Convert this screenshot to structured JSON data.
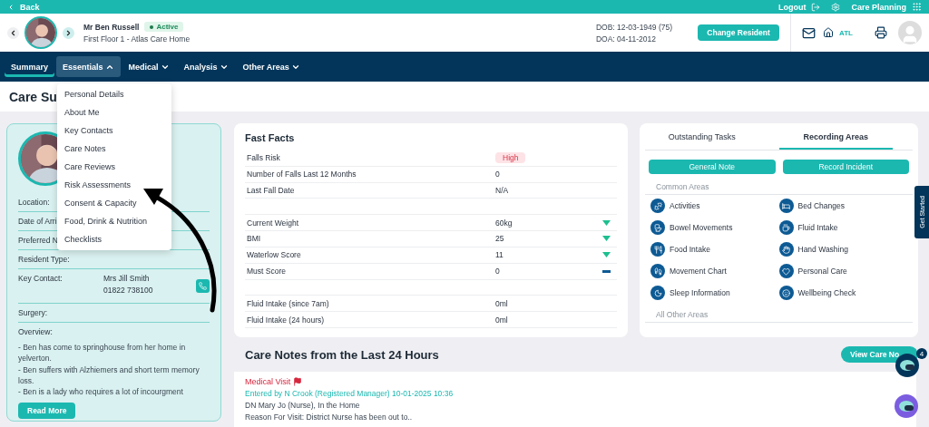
{
  "top_bar": {
    "back": "Back",
    "logout": "Logout",
    "app": "Care Planning"
  },
  "resident": {
    "name": "Mr Ben Russell",
    "status": "Active",
    "location": "First Floor 1 - Atlas Care Home",
    "dob": "DOB: 12-03-1949 (75)",
    "doa": "DOA: 04-11-2012",
    "change_button": "Change Resident",
    "home_code": "ATL"
  },
  "nav": [
    {
      "label": "Summary",
      "selected": true,
      "expanded": false,
      "dropdown": false
    },
    {
      "label": "Essentials",
      "selected": false,
      "expanded": true,
      "dropdown": true
    },
    {
      "label": "Medical",
      "selected": false,
      "expanded": false,
      "dropdown": true
    },
    {
      "label": "Analysis",
      "selected": false,
      "expanded": false,
      "dropdown": true
    },
    {
      "label": "Other Areas",
      "selected": false,
      "expanded": false,
      "dropdown": true
    }
  ],
  "dropdown_items": [
    "Personal Details",
    "About Me",
    "Key Contacts",
    "Care Notes",
    "Care Reviews",
    "Risk Assessments",
    "Consent & Capacity",
    "Food, Drink & Nutrition",
    "Checklists"
  ],
  "page_title": "Care Su",
  "profile": {
    "rows": [
      {
        "label": "Location:"
      },
      {
        "label": "Date of Arri"
      },
      {
        "label": "Preferred N"
      },
      {
        "label": "Resident Type:"
      }
    ],
    "key_contact": {
      "label": "Key Contact:",
      "name": "Mrs Jill Smith",
      "phone": "01822 738100"
    },
    "surgery": "Surgery:",
    "overview_label": "Overview:",
    "overview": [
      "- Ben has come to springhouse from her home in yelverton.",
      "- Ben suffers with Alzhiemers and short term memory loss.",
      "- Ben is a lady who requires a lot of incourgment"
    ],
    "read_more": "Read More"
  },
  "fast_facts": {
    "title": "Fast Facts",
    "rows": [
      {
        "kind": "badge",
        "label": "Falls Risk",
        "value": "High"
      },
      {
        "kind": "text",
        "label": "Number of Falls Last 12 Months",
        "value": "0"
      },
      {
        "kind": "text",
        "label": "Last Fall Date",
        "value": "N/A"
      },
      {
        "kind": "gap"
      },
      {
        "kind": "text",
        "label": "Current Weight",
        "value": "60kg",
        "trend_down": true
      },
      {
        "kind": "text",
        "label": "BMI",
        "value": "25",
        "trend_down": true
      },
      {
        "kind": "text",
        "label": "Waterlow Score",
        "value": "11",
        "trend_down": true
      },
      {
        "kind": "text",
        "label": "Must Score",
        "value": "0",
        "trend_down": false
      },
      {
        "kind": "gap"
      },
      {
        "kind": "text",
        "label": "Fluid Intake (since 7am)",
        "value": "0ml"
      },
      {
        "kind": "text",
        "label": "Fluid Intake (24 hours)",
        "value": "0ml"
      }
    ]
  },
  "recording": {
    "tabs": [
      {
        "label": "Outstanding Tasks",
        "selected": false
      },
      {
        "label": "Recording Areas",
        "selected": true
      }
    ],
    "buttons": [
      "General Note",
      "Record Incident"
    ],
    "common_label": "Common Areas",
    "areas": [
      "Activities",
      "Bed Changes",
      "Bowel Movements",
      "Fluid Intake",
      "Food Intake",
      "Hand Washing",
      "Movement Chart",
      "Personal Care",
      "Sleep Information",
      "Wellbeing Check"
    ],
    "other_label": "All Other Areas"
  },
  "care_notes": {
    "title": "Care Notes from the Last 24 Hours",
    "view_button": "View Care No",
    "note": {
      "title": "Medical Visit",
      "entered": "Entered by N Crook (Registered Manager) 10-01-2025 10:36",
      "lines": [
        "DN Mary Jo (Nurse), In the Home",
        "Reason For Visit: District Nurse has been out to.."
      ]
    }
  },
  "chat_badge": "4",
  "get_started": "Get Started"
}
